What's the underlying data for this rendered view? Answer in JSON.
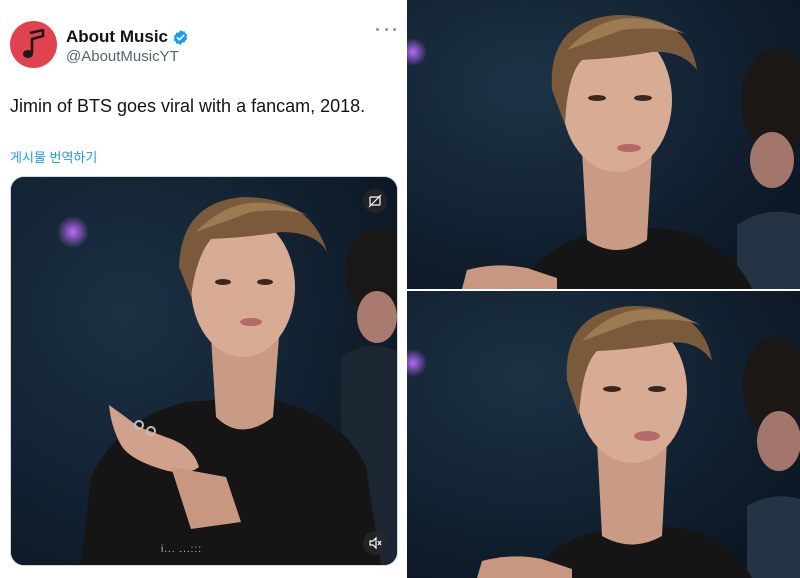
{
  "tweet": {
    "display_name": "About Music",
    "handle": "@AboutMusicYT",
    "text": "Jimin of BTS goes viral with a fancam, 2018.",
    "translate_link": "게시물 번역하기",
    "caption_text": "i... ...:::"
  },
  "icons": {
    "avatar": "music-note-icon",
    "verified": "verified-badge-icon",
    "more": "more-options-icon",
    "media_toggle": "sensitive-toggle-icon",
    "mute": "speaker-muted-icon"
  },
  "colors": {
    "avatar_bg": "#e0424f",
    "verified": "#1d9bf0",
    "link": "#1d9bf0",
    "stage_bg": "#0e1b28"
  }
}
